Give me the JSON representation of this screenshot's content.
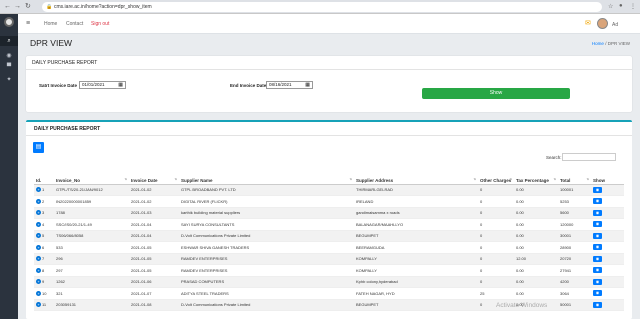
{
  "browser": {
    "url": "cms.iare.ac.in/home?action=dpr_show_item"
  },
  "topnav": {
    "home": "Home",
    "contact": "Contact",
    "signout": "Sign out",
    "user_initials": "Ad"
  },
  "page": {
    "title": "DPR VIEW",
    "breadcrumb_home": "Home",
    "breadcrumb_sep": "/",
    "breadcrumb_current": "DPR VIEW"
  },
  "purchase_card": {
    "title": "DAILY PURCHASE REPORT",
    "start_label": "Satrt Invoice Date",
    "start_value": "01/01/2021",
    "end_label": "End Invoice Date",
    "end_value": "08/16/2021",
    "show_button": "Show"
  },
  "report": {
    "title": "DAILY PURCHASE REPORT",
    "search_label": "Search:",
    "columns": [
      "Id.",
      "Invoice_No",
      "Invoice Date",
      "Supplier Name",
      "Supplier Address",
      "Other Charges",
      "Tax Percentage",
      "Total",
      "Show"
    ],
    "rows": [
      [
        "1",
        "GTPL/TS/20-21/JAN/9012",
        "2021-01-02",
        "GTPL BROADBAND PVT. LTD",
        "THIRMARLGELRAD",
        "0",
        "0.00",
        "100001"
      ],
      [
        "2",
        "IN20220000001859",
        "2021-01-02",
        "DIGITAL RIVER (FLICKR)",
        "IRELAND",
        "0",
        "0.00",
        "5253"
      ],
      [
        "3",
        "1788",
        "2021-01-03",
        "karthik building material suppliers",
        "gandimaisamma x roads",
        "0",
        "0.00",
        "5600"
      ],
      [
        "4",
        "SSC/IS0/20-21/1-49",
        "2021-01-04",
        "SAYI SURYA CONSULTANTS",
        "BALANAGAR/MAAHLLYO",
        "0",
        "0.00",
        "120000"
      ],
      [
        "5",
        "TS06/066/8058",
        "2021-01-04",
        "D-Volt Communications Private Limited",
        "BEGUMPET",
        "0",
        "0.00",
        "30001"
      ],
      [
        "6",
        "533",
        "2021-01-05",
        "ESHWAR SHIVA GANESH TRADERS",
        "BEERAMGUDA",
        "0",
        "0.00",
        "28900"
      ],
      [
        "7",
        "296",
        "2021-01-05",
        "RAMDEV ENTERPRISES",
        "KOMPALLY",
        "0",
        "12.00",
        "20720"
      ],
      [
        "8",
        "297",
        "2021-01-05",
        "RAMDEV ENTERPRISES",
        "KOMPALLY",
        "0",
        "0.00",
        "27941"
      ],
      [
        "9",
        "1262",
        "2021-01-06",
        "PRASAD COMPUTERS",
        "Kphb colony,hyderabad",
        "0",
        "0.00",
        "4200"
      ],
      [
        "10",
        "321",
        "2021-01-07",
        "ADITYA STEEL TRADERS",
        "FATEH NAGAR, HYD",
        "25",
        "0.00",
        "3064"
      ],
      [
        "11",
        "203059131",
        "2021-01-08",
        "D-Volt Communications Private Limited",
        "BEGUMPET",
        "0",
        "0.00",
        "50001"
      ]
    ]
  },
  "watermark": "Activate Windows"
}
